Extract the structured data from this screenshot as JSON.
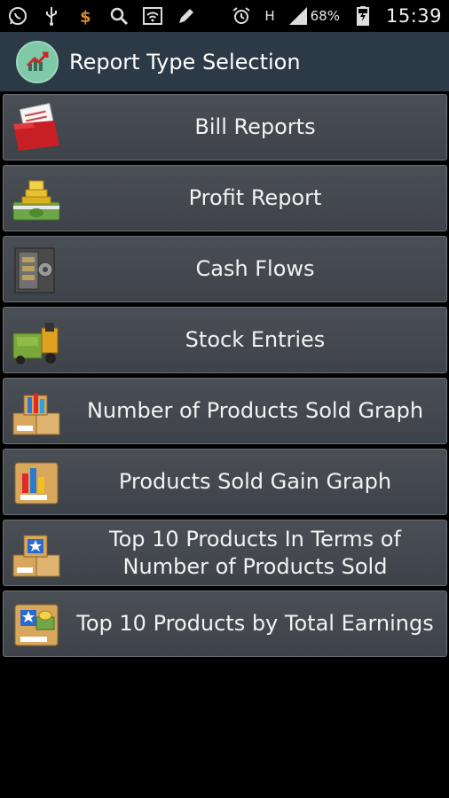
{
  "status_bar": {
    "battery_percent": "68%",
    "network_label": "H",
    "time": "15:39"
  },
  "header": {
    "title": "Report Type Selection",
    "logo_icon": "chart-arrow-icon"
  },
  "reports": [
    {
      "label": "Bill Reports",
      "icon": "folder-bills-icon"
    },
    {
      "label": "Profit Report",
      "icon": "money-gold-icon"
    },
    {
      "label": "Cash Flows",
      "icon": "safe-icon"
    },
    {
      "label": "Stock Entries",
      "icon": "forklift-icon"
    },
    {
      "label": "Number of Products Sold Graph",
      "icon": "boxes-chart-icon"
    },
    {
      "label": "Products Sold Gain Graph",
      "icon": "box-chart-icon"
    },
    {
      "label": "Top 10 Products In Terms of Number of Products Sold",
      "icon": "boxes-star-icon"
    },
    {
      "label": "Top 10 Products by Total Earnings",
      "icon": "box-star-money-icon"
    }
  ],
  "colors": {
    "action_bar": "#2c3a48",
    "item_bg": "#444950",
    "background": "#000000"
  }
}
